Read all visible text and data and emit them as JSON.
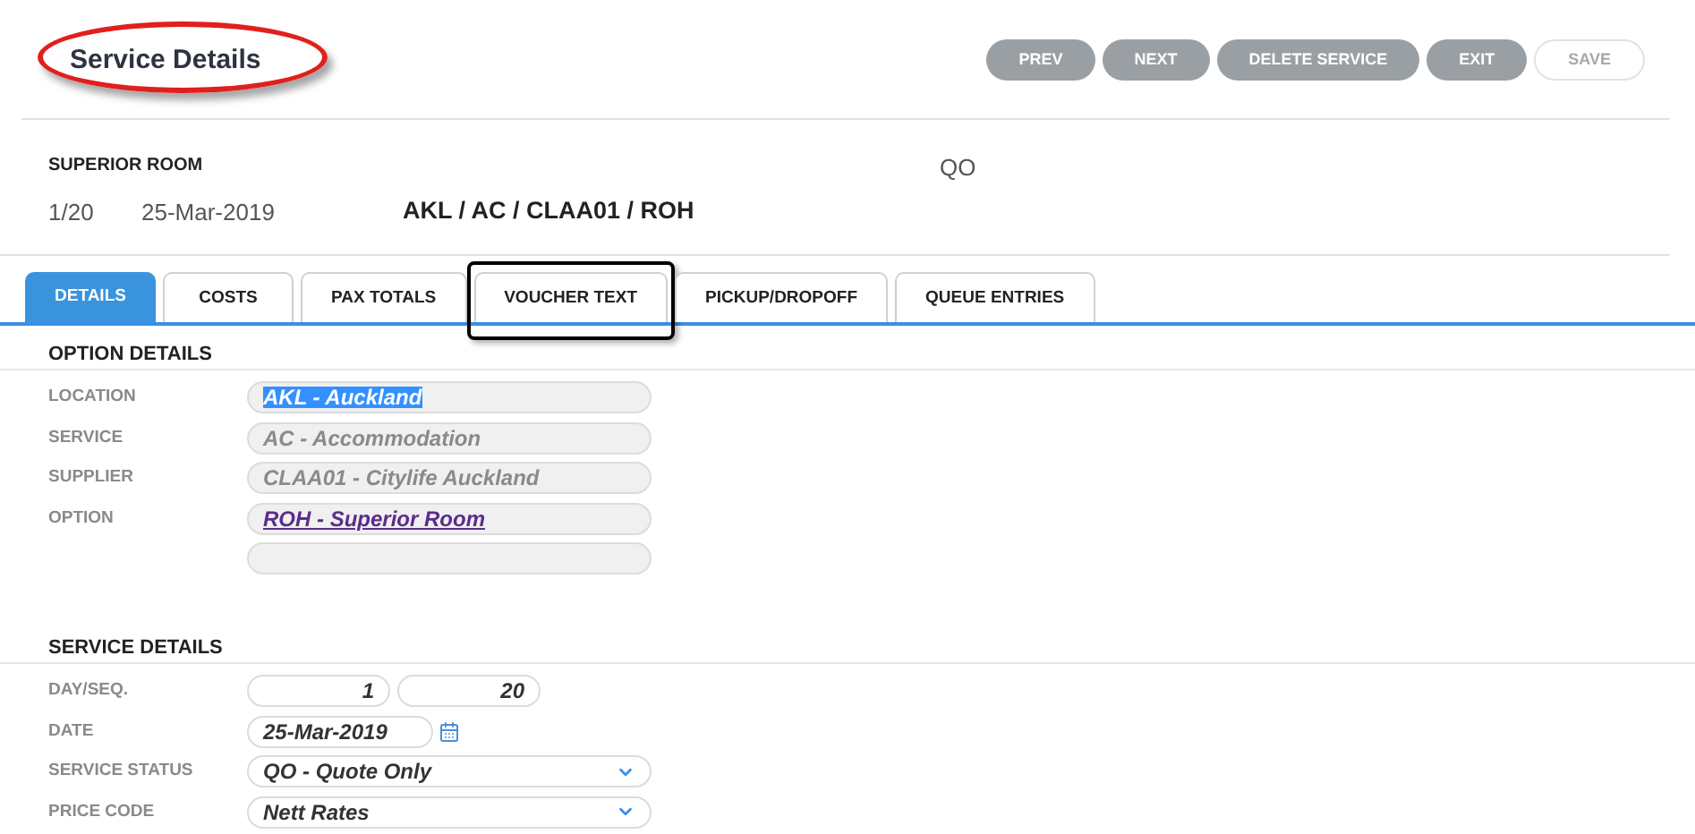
{
  "title": {
    "text": "Service Details",
    "circled": true
  },
  "buttons": [
    {
      "label": "PREV",
      "disabled": false
    },
    {
      "label": "NEXT",
      "disabled": false
    },
    {
      "label": "DELETE SERVICE",
      "disabled": false
    },
    {
      "label": "EXIT",
      "disabled": false
    },
    {
      "label": "SAVE",
      "disabled": true
    }
  ],
  "summary": {
    "name": "SUPERIOR ROOM",
    "status": "QO",
    "day_seq": "1/20",
    "date": "25-Mar-2019",
    "code": "AKL / AC / CLAA01 / ROH"
  },
  "tabs": [
    {
      "label": "DETAILS",
      "selected": true,
      "outlined": false
    },
    {
      "label": "COSTS",
      "selected": false,
      "outlined": false
    },
    {
      "label": "PAX TOTALS",
      "selected": false,
      "outlined": false
    },
    {
      "label": "VOUCHER TEXT",
      "selected": false,
      "outlined": true
    },
    {
      "label": "PICKUP/DROPOFF",
      "selected": false,
      "outlined": false
    },
    {
      "label": "QUEUE ENTRIES",
      "selected": false,
      "outlined": false
    }
  ],
  "option_details": {
    "heading": "OPTION DETAILS",
    "fields": [
      {
        "label": "LOCATION",
        "kind": "selected",
        "value": "AKL - Auckland"
      },
      {
        "label": "SERVICE",
        "kind": "readonly",
        "value": "AC - Accommodation"
      },
      {
        "label": "SUPPLIER",
        "kind": "readonly",
        "value": "CLAA01 - Citylife Auckland"
      },
      {
        "label": "OPTION",
        "kind": "link",
        "value": "ROH - Superior Room"
      },
      {
        "kind": "empty"
      }
    ]
  },
  "service_details": {
    "heading": "SERVICE DETAILS",
    "fields": [
      {
        "label": "DAY/SEQ.",
        "kind": "pair",
        "values": [
          "1",
          "20"
        ]
      },
      {
        "label": "DATE",
        "kind": "date",
        "value": "25-Mar-2019"
      },
      {
        "label": "SERVICE STATUS",
        "kind": "select",
        "value": "QO - Quote Only"
      },
      {
        "label": "PRICE CODE",
        "kind": "select",
        "value": "Nett Rates"
      }
    ]
  }
}
